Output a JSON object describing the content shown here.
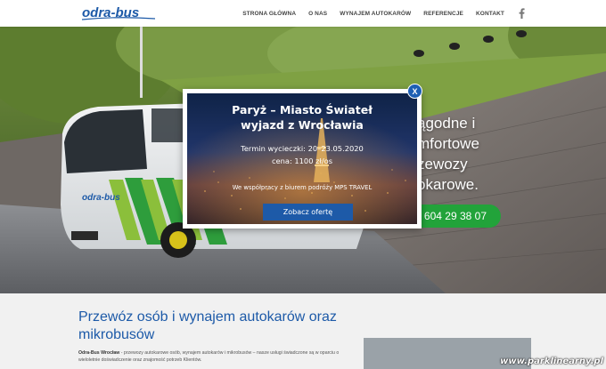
{
  "header": {
    "logo_text": "odra-bus",
    "nav": [
      {
        "label": "STRONA GŁÓWNA"
      },
      {
        "label": "O NAS"
      },
      {
        "label": "WYNAJEM AUTOKARÓW"
      },
      {
        "label": "REFERENCJE"
      },
      {
        "label": "KONTAKT"
      }
    ],
    "social_icon": "facebook-icon"
  },
  "hero": {
    "text_lines": [
      "ągodne i",
      "mfortowe",
      "zewozy",
      "okarowe."
    ],
    "phone": "604 29 38 07",
    "accent_color": "#22a33a"
  },
  "modal": {
    "title_line1": "Paryż – Miasto Świateł",
    "title_line2": "wyjazd z Wrocławia",
    "dates": "Termin wycieczki: 20–23.05.2020",
    "price": "cena: 1100 zł/os",
    "note": "We współpracy z biurem podróży MPS TRAVEL",
    "cta": "Zobacz ofertę",
    "close": "X",
    "button_color": "#1d5aa8"
  },
  "main": {
    "heading": "Przewóz osób i wynajem autokarów oraz mikrobusów",
    "para_bold": "Odra-Bus Wrocław",
    "para_text": " - przewozy autokarowe osób, wynajem autokarów i mikrobusów – nasze usługi świadczone są w oparciu o wieloletnie doświadczenie oraz znajomość potrzeb Klientów."
  },
  "watermark": "www.parklinearny.pl"
}
